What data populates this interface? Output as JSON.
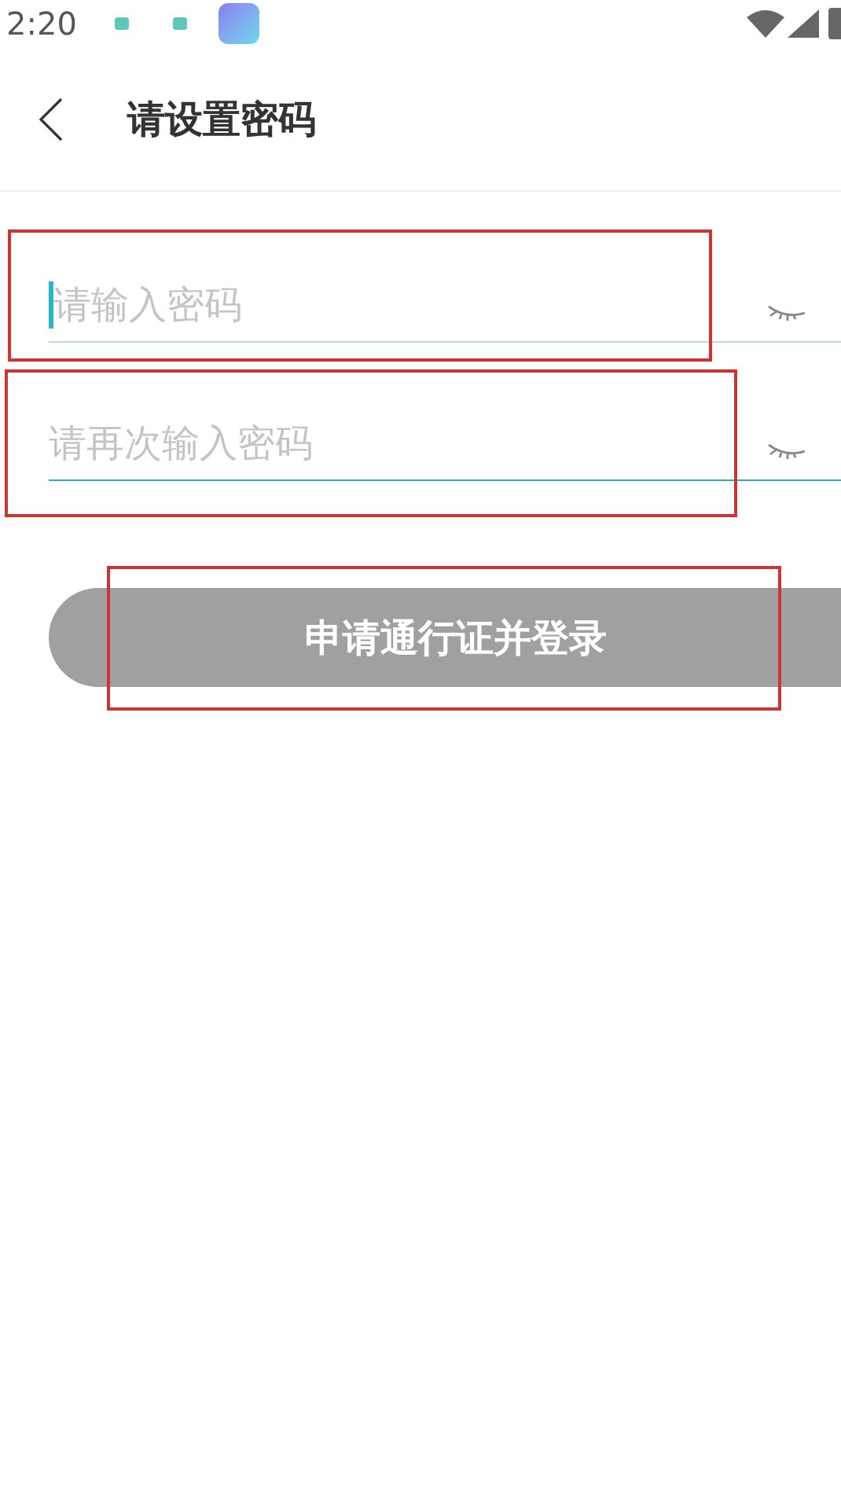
{
  "status_bar": {
    "time": "2:20"
  },
  "header": {
    "title": "请设置密码"
  },
  "fields": [
    {
      "placeholder": "请输入密码",
      "focused": true
    },
    {
      "placeholder": "请再次输入密码",
      "focused": false
    }
  ],
  "submit_button": {
    "label": "申请通行证并登录",
    "disabled": true
  }
}
